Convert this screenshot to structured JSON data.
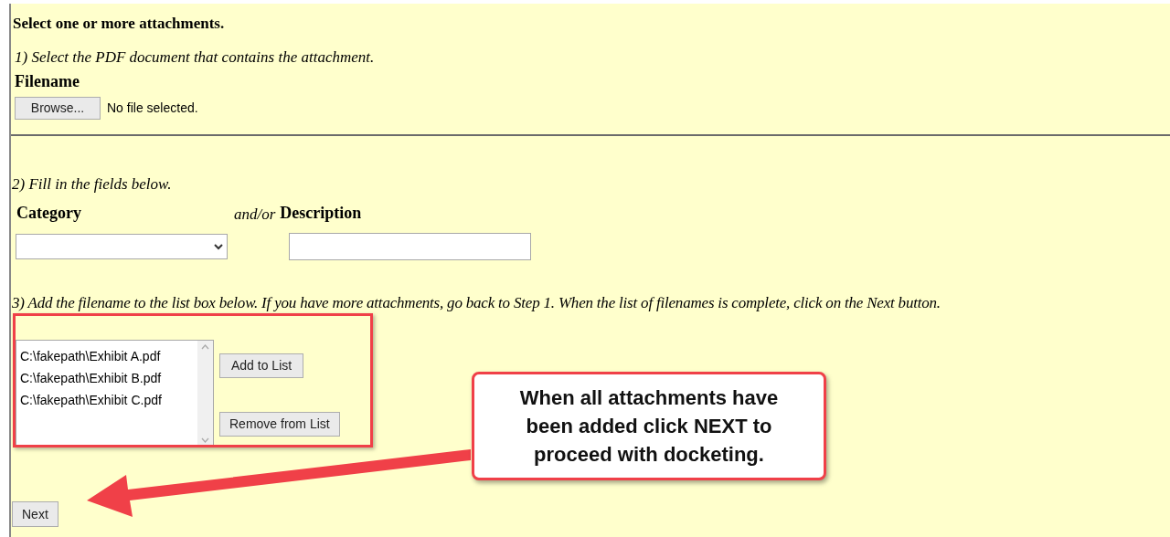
{
  "title": "Select one or more attachments.",
  "step1": {
    "instruction": "1) Select the PDF document that contains the attachment.",
    "filename_label": "Filename",
    "browse_button": "Browse...",
    "file_status": "No file selected."
  },
  "step2": {
    "instruction": "2) Fill in the fields below.",
    "category_label": "Category",
    "connector": "and/or",
    "description_label": "Description"
  },
  "step3": {
    "instruction": "3) Add the filename to the list box below. If you have more attachments, go back to Step 1. When the list of filenames is complete, click on the Next button.",
    "list_items": [
      "C:\\fakepath\\Exhibit A.pdf",
      "C:\\fakepath\\Exhibit B.pdf",
      "C:\\fakepath\\Exhibit C.pdf"
    ],
    "add_button": "Add to List",
    "remove_button": "Remove from List"
  },
  "next_button": "Next",
  "callout": {
    "text": "When all attachments have been added click NEXT to proceed with docketing."
  }
}
